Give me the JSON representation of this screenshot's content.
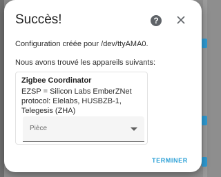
{
  "dialog": {
    "title": "Succès!",
    "help_icon": "question-circle-icon",
    "help_glyph": "?",
    "close_icon": "close-icon",
    "config_message": "Configuration créée pour /dev/ttyAMA0.",
    "found_message": "Nous avons trouvé les appareils suivants:",
    "device": {
      "name": "Zigbee Coordinator",
      "description": "EZSP = Silicon Labs EmberZNet protocol: Elelabs, HUSBZB-1, Telegesis (ZHA)",
      "area_label": "Pièce",
      "dropdown_icon": "chevron-down-icon"
    },
    "finish_label": "TERMINER"
  },
  "colors": {
    "accent": "#2a9fd6",
    "overlay": "#8e8e8e",
    "dialog_bg": "#ffffff"
  }
}
